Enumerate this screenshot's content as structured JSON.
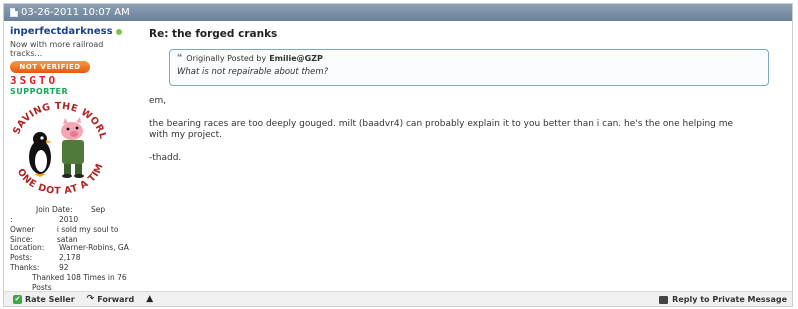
{
  "post": {
    "date": "03-26-2011 10:07 AM",
    "title": "Re: the forged cranks"
  },
  "user": {
    "username": "inperfectdarkness",
    "user_title": "Now with more railroad tracks...",
    "badge_verified": "NOT VERIFIED",
    "badge_3sgto": "3SGTO",
    "badge_supporter": "SUPPORTER",
    "avatar_text_top": "SAVING THE WORLD",
    "avatar_text_bottom": "ONE DOT AT A TIME",
    "join_date_label": "Join Date:",
    "join_date_month": "Sep",
    "join_date_colon": ":",
    "join_date_year": "2010",
    "owner_since_label": "Owner Since:",
    "owner_since_value": "i sold my soul to satan",
    "location_label": "Location:",
    "location_value": "Warner-Robins, GA",
    "posts_label": "Posts:",
    "posts_value": "2,178",
    "thanks_label": "Thanks:",
    "thanks_value": "92",
    "thanked_text": "Thanked 108 Times in 76 Posts"
  },
  "quote": {
    "prefix": "Originally Posted by",
    "author": "Emilie@GZP",
    "text": "What is not repairable about them?"
  },
  "message": {
    "line1": "em,",
    "line2": "the bearing races are too deeply gouged. milt (baadvr4) can probably explain it to you better than i can. he's the one helping me with my project.",
    "line3": "-thadd."
  },
  "footer": {
    "rate_seller": "Rate Seller",
    "forward": "Forward",
    "reply_private": "Reply to Private Message"
  },
  "colors": {
    "header_bg": "#7a8ea6",
    "username": "#1b3f88",
    "quote_border": "#7fa7c9",
    "online": "#7fc24b"
  }
}
